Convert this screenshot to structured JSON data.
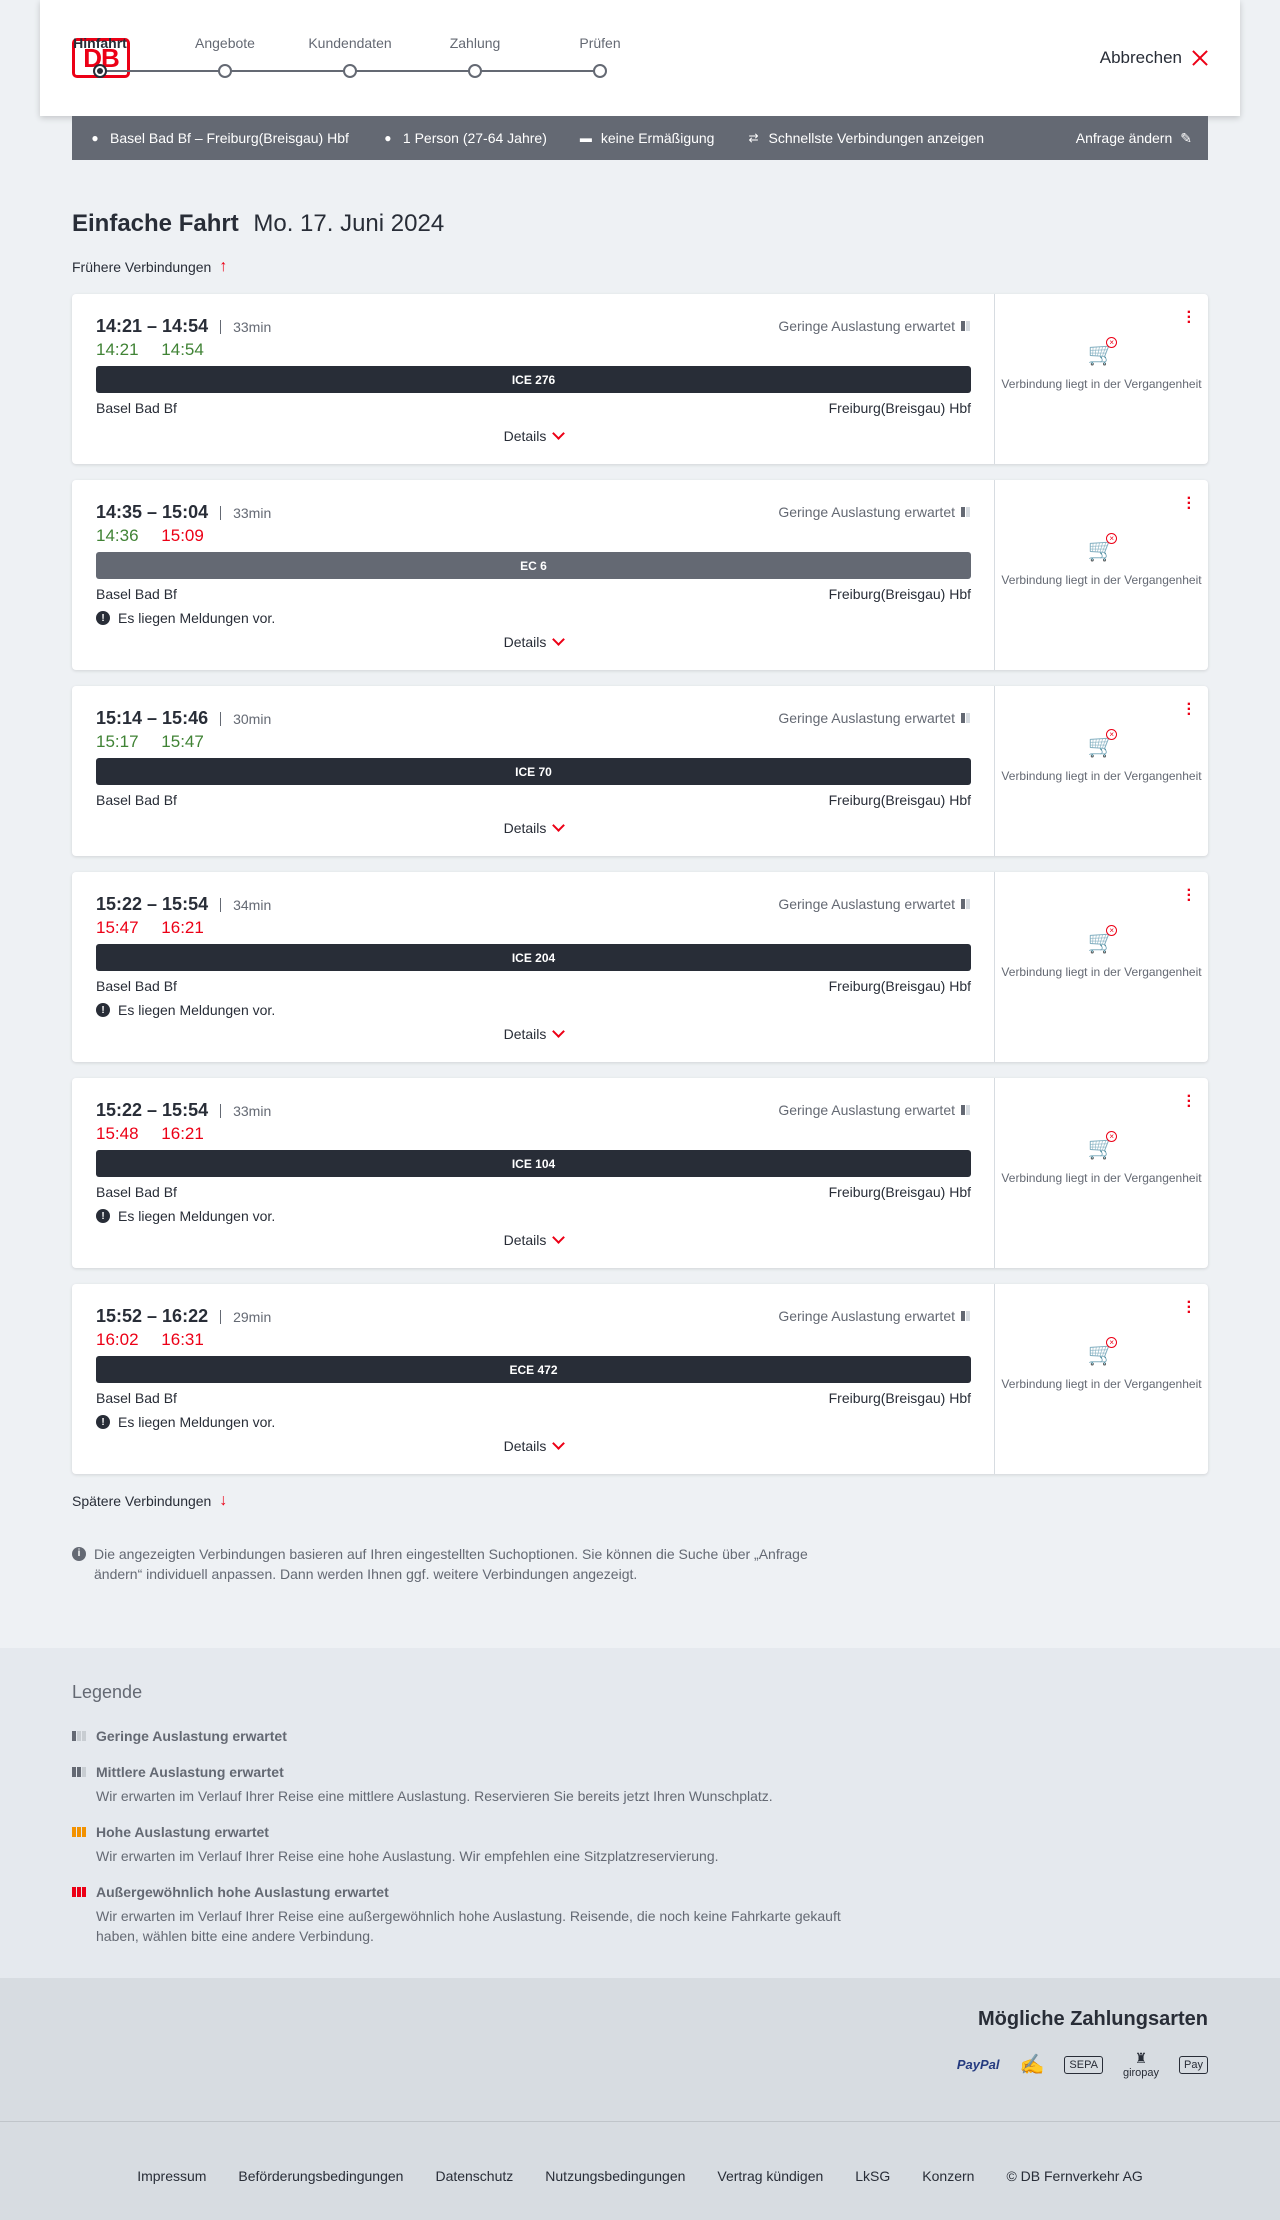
{
  "header": {
    "logo": "DB",
    "steps": [
      {
        "label": "Hinfahrt",
        "active": true
      },
      {
        "label": "Angebote",
        "active": false
      },
      {
        "label": "Kundendaten",
        "active": false
      },
      {
        "label": "Zahlung",
        "active": false
      },
      {
        "label": "Prüfen",
        "active": false
      }
    ],
    "cancel_label": "Abbrechen"
  },
  "request_bar": {
    "route": "Basel Bad Bf – Freiburg(Breisgau) Hbf",
    "travellers": "1 Person (27-64 Jahre)",
    "discount": "keine Ermäßigung",
    "fastest": "Schnellste Verbindungen anzeigen",
    "change_label": "Anfrage ändern"
  },
  "page": {
    "title": "Einfache Fahrt",
    "date": "Mo. 17. Juni 2024",
    "earlier_label": "Frühere Verbindungen",
    "later_label": "Spätere Verbindungen",
    "info_text": "Die angezeigten Verbindungen basieren auf Ihren eingestellten Suchoptionen. Sie können die Suche über „Anfrage ändern“ individuell anpassen. Dann werden Ihnen ggf. weitere Verbindungen angezeigt."
  },
  "connections": [
    {
      "times": "14:21 – 14:54",
      "duration": "33min",
      "rt_dep": "14:21",
      "rt_arr": "14:54",
      "rt_status": "green",
      "load": "Geringe Auslastung erwartet",
      "train": "ICE 276",
      "train_type": "ice",
      "from": "Basel Bad Bf",
      "to": "Freiburg(Breisgau) Hbf",
      "notice": "",
      "details_label": "Details",
      "side_text": "Verbindung liegt in der Vergangenheit"
    },
    {
      "times": "14:35 – 15:04",
      "duration": "33min",
      "rt_dep": "14:36",
      "rt_arr": "15:09",
      "rt_status": "mixed",
      "load": "Geringe Auslastung erwartet",
      "train": "EC 6",
      "train_type": "ec",
      "from": "Basel Bad Bf",
      "to": "Freiburg(Breisgau) Hbf",
      "notice": "Es liegen Meldungen vor.",
      "details_label": "Details",
      "side_text": "Verbindung liegt in der Vergangenheit"
    },
    {
      "times": "15:14 – 15:46",
      "duration": "30min",
      "rt_dep": "15:17",
      "rt_arr": "15:47",
      "rt_status": "green",
      "load": "Geringe Auslastung erwartet",
      "train": "ICE 70",
      "train_type": "ice",
      "from": "Basel Bad Bf",
      "to": "Freiburg(Breisgau) Hbf",
      "notice": "",
      "details_label": "Details",
      "side_text": "Verbindung liegt in der Vergangenheit"
    },
    {
      "times": "15:22 – 15:54",
      "duration": "34min",
      "rt_dep": "15:47",
      "rt_arr": "16:21",
      "rt_status": "red",
      "load": "Geringe Auslastung erwartet",
      "train": "ICE 204",
      "train_type": "ice",
      "from": "Basel Bad Bf",
      "to": "Freiburg(Breisgau) Hbf",
      "notice": "Es liegen Meldungen vor.",
      "details_label": "Details",
      "side_text": "Verbindung liegt in der Vergangenheit"
    },
    {
      "times": "15:22 – 15:54",
      "duration": "33min",
      "rt_dep": "15:48",
      "rt_arr": "16:21",
      "rt_status": "red",
      "load": "Geringe Auslastung erwartet",
      "train": "ICE 104",
      "train_type": "ice",
      "from": "Basel Bad Bf",
      "to": "Freiburg(Breisgau) Hbf",
      "notice": "Es liegen Meldungen vor.",
      "details_label": "Details",
      "side_text": "Verbindung liegt in der Vergangenheit"
    },
    {
      "times": "15:52 – 16:22",
      "duration": "29min",
      "rt_dep": "16:02",
      "rt_arr": "16:31",
      "rt_status": "red",
      "load": "Geringe Auslastung erwartet",
      "train": "ECE 472",
      "train_type": "ice",
      "from": "Basel Bad Bf",
      "to": "Freiburg(Breisgau) Hbf",
      "notice": "Es liegen Meldungen vor.",
      "details_label": "Details",
      "side_text": "Verbindung liegt in der Vergangenheit"
    }
  ],
  "legend": {
    "title": "Legende",
    "items": [
      {
        "title": "Geringe Auslastung erwartet",
        "desc": "",
        "level": "low",
        "color": "#646973"
      },
      {
        "title": "Mittlere Auslastung erwartet",
        "desc": "Wir erwarten im Verlauf Ihrer Reise eine mittlere Auslastung. Reservieren Sie bereits jetzt Ihren Wunschplatz.",
        "level": "medium",
        "color": "#646973"
      },
      {
        "title": "Hohe Auslastung erwartet",
        "desc": "Wir erwarten im Verlauf Ihrer Reise eine hohe Auslastung. Wir empfehlen eine Sitzplatzreservierung.",
        "level": "high",
        "color": "#f39200"
      },
      {
        "title": "Außergewöhnlich hohe Auslastung erwartet",
        "desc": "Wir erwarten im Verlauf Ihrer Reise eine außergewöhnlich hohe Auslastung. Reisende, die noch keine Fahrkarte gekauft haben, wählen bitte eine andere Verbindung.",
        "level": "extreme",
        "color": "#ec0016"
      }
    ]
  },
  "payment": {
    "title": "Mögliche Zahlungsarten",
    "methods": [
      "PayPal",
      "",
      "SEPA",
      "giropay",
      "Pay"
    ]
  },
  "footer": {
    "links": [
      "Impressum",
      "Beförderungsbedingungen",
      "Datenschutz",
      "Nutzungsbedingungen",
      "Vertrag kündigen",
      "LkSG",
      "Konzern",
      "© DB Fernverkehr AG"
    ]
  },
  "colors": {
    "accent": "#ec0016",
    "on_time": "#408335",
    "delayed": "#ec0016",
    "dark": "#282d37"
  }
}
